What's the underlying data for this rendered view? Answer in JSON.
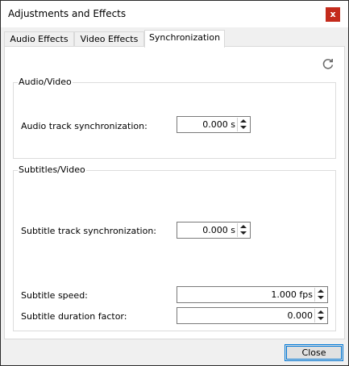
{
  "window": {
    "title": "Adjustments and Effects",
    "close_glyph": "x"
  },
  "tabs": [
    {
      "label": "Audio Effects"
    },
    {
      "label": "Video Effects"
    },
    {
      "label": "Synchronization"
    }
  ],
  "icons": {
    "refresh": "refresh-icon"
  },
  "audio_video": {
    "title": "Audio/Video",
    "audio_sync_label": "Audio track synchronization:",
    "audio_sync_value": "0.000 s"
  },
  "subtitles_video": {
    "title": "Subtitles/Video",
    "subtitle_sync_label": "Subtitle track synchronization:",
    "subtitle_sync_value": "0.000 s",
    "subtitle_speed_label": "Subtitle speed:",
    "subtitle_speed_value": "1.000 fps",
    "subtitle_duration_label": "Subtitle duration factor:",
    "subtitle_duration_value": "0.000"
  },
  "footer": {
    "close_label": "Close"
  },
  "colors": {
    "accent": "#0078d7",
    "close_red": "#c42b1c"
  }
}
